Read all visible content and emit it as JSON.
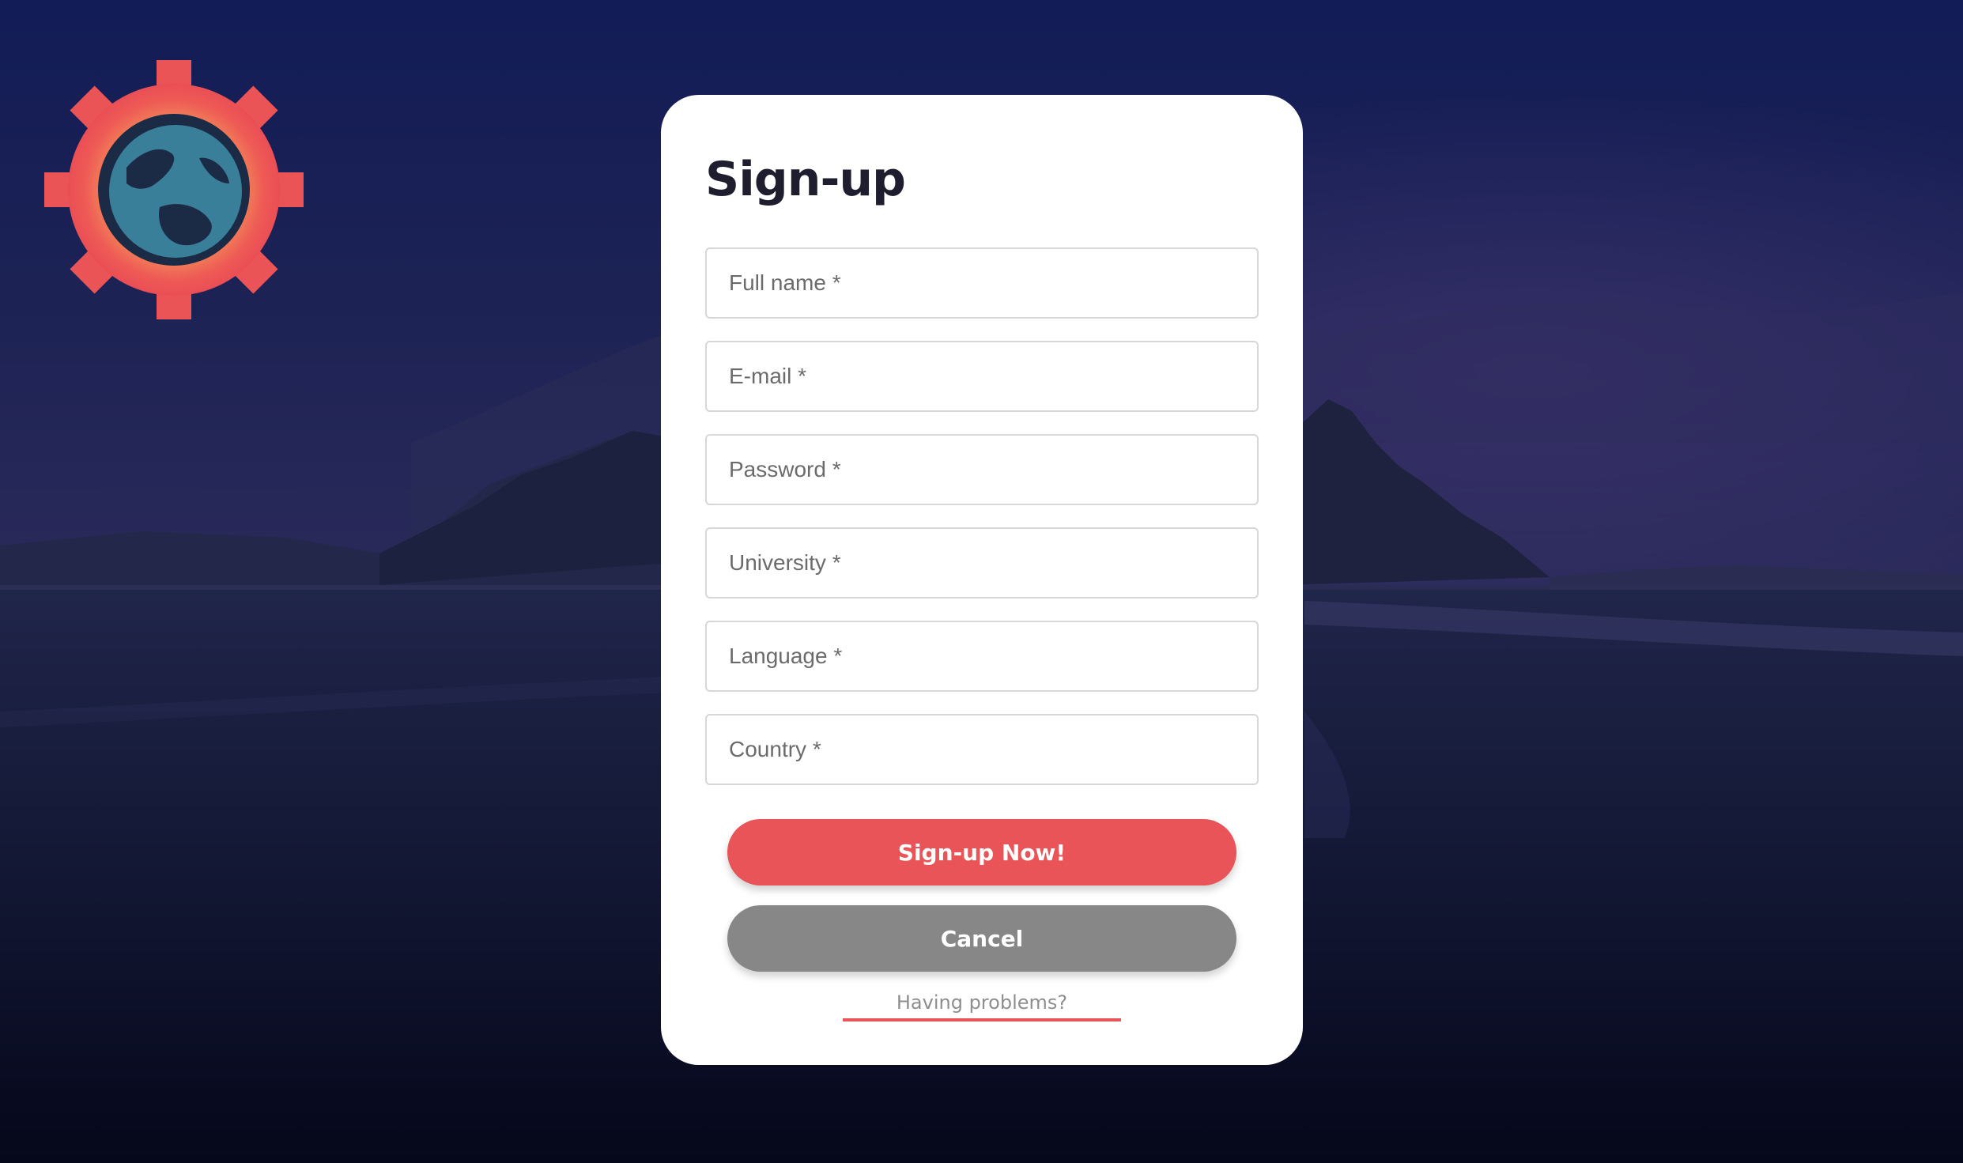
{
  "form": {
    "title": "Sign-up",
    "fields": [
      {
        "name": "full-name",
        "placeholder": "Full name *",
        "value": ""
      },
      {
        "name": "email",
        "placeholder": "E-mail *",
        "value": ""
      },
      {
        "name": "password",
        "placeholder": "Password *",
        "value": ""
      },
      {
        "name": "university",
        "placeholder": "University *",
        "value": ""
      },
      {
        "name": "language",
        "placeholder": "Language *",
        "value": ""
      },
      {
        "name": "country",
        "placeholder": "Country *",
        "value": ""
      }
    ],
    "submit_label": "Sign-up Now!",
    "cancel_label": "Cancel",
    "help_link": "Having problems?"
  },
  "logo": {
    "icon": "gear-globe-logo-icon"
  },
  "colors": {
    "accent": "#e85457",
    "cancel": "#878787",
    "title": "#1e1e2e",
    "card": "#ffffff"
  }
}
